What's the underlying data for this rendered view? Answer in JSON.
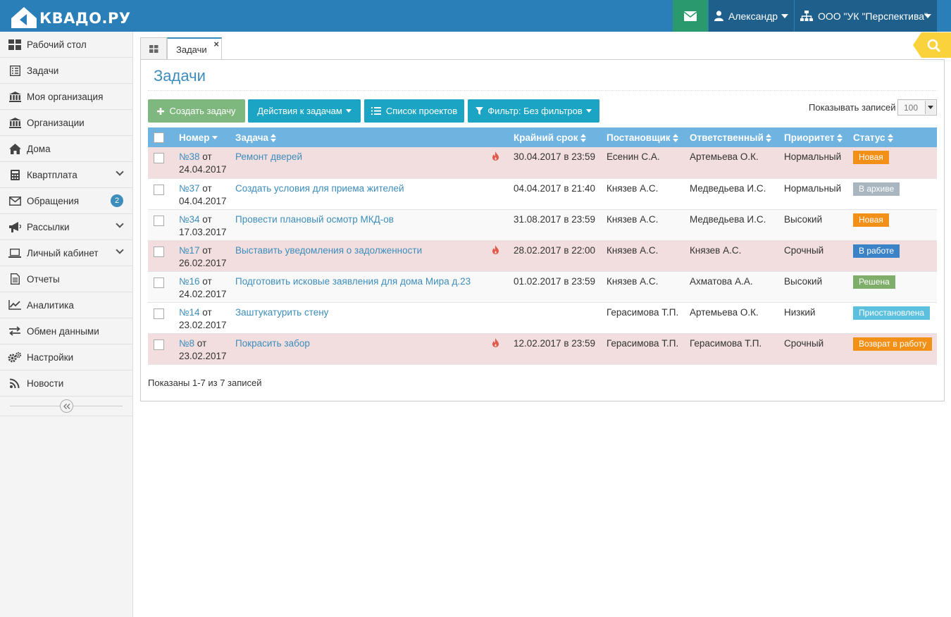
{
  "brand": {
    "logo_text": "КВАДО.РУ"
  },
  "header": {
    "user_name": "Александр",
    "org_name": "ООО \"УК \"Перспектива\""
  },
  "sidebar": {
    "items": [
      {
        "label": "Рабочий стол",
        "icon": "dashboard-icon"
      },
      {
        "label": "Задачи",
        "icon": "tasks-list-icon"
      },
      {
        "label": "Моя организация",
        "icon": "institution-icon"
      },
      {
        "label": "Организации",
        "icon": "institution-icon"
      },
      {
        "label": "Дома",
        "icon": "home-icon"
      },
      {
        "label": "Квартплата",
        "icon": "calculator-icon"
      },
      {
        "label": "Обращения",
        "icon": "envelope-icon",
        "badge": "2"
      },
      {
        "label": "Рассылки",
        "icon": "bullhorn-icon"
      },
      {
        "label": "Личный кабинет",
        "icon": "laptop-icon"
      },
      {
        "label": "Отчеты",
        "icon": "document-icon"
      },
      {
        "label": "Аналитика",
        "icon": "line-chart-icon"
      },
      {
        "label": "Обмен данными",
        "icon": "exchange-icon"
      },
      {
        "label": "Настройки",
        "icon": "gears-icon"
      },
      {
        "label": "Новости",
        "icon": "rss-icon"
      }
    ]
  },
  "tabs": {
    "active_label": "Задачи",
    "close_glyph": "×"
  },
  "page": {
    "title": "Задачи",
    "create_label": "Создать задачу",
    "actions_label": "Действия к задачам",
    "projects_label": "Список проектов",
    "filter_label": "Фильтр: Без фильтров",
    "show_label": "Показывать записей",
    "show_value": "100",
    "footer": "Показаны 1-7 из 7 записей"
  },
  "table": {
    "headers": {
      "number": "Номер",
      "task": "Задача",
      "deadline": "Крайний срок",
      "author": "Постановщик",
      "assignee": "Ответственный",
      "priority": "Приоритет",
      "status": "Статус"
    },
    "rows": [
      {
        "num": "№38",
        "from": "от",
        "date": "24.04.2017",
        "task": "Ремонт дверей",
        "urgent": true,
        "deadline": "30.04.2017 в 23:59",
        "author": "Есенин С.А.",
        "assignee": "Артемьева О.К.",
        "priority": "Нормальный",
        "status": "Новая",
        "status_color": "#f39018"
      },
      {
        "num": "№37",
        "from": "от",
        "date": "04.04.2017",
        "task": "Создать условия для приема жителей",
        "urgent": false,
        "deadline": "04.04.2017 в 21:40",
        "author": "Князев А.С.",
        "assignee": "Медведьева И.С.",
        "priority": "Нормальный",
        "status": "В архиве",
        "status_color": "#a9b6c0"
      },
      {
        "num": "№34",
        "from": "от",
        "date": "17.03.2017",
        "task": "Провести плановый осмотр МКД-ов",
        "urgent": false,
        "deadline": "31.08.2017 в 23:59",
        "author": "Князев А.С.",
        "assignee": "Медведьева И.С.",
        "priority": "Высокий",
        "status": "Новая",
        "status_color": "#f39018"
      },
      {
        "num": "№17",
        "from": "от",
        "date": "26.02.2017",
        "task": "Выставить уведомления о задолженности",
        "urgent": true,
        "deadline": "28.02.2017 в 22:00",
        "author": "Князев А.С.",
        "assignee": "Князев А.С.",
        "priority": "Срочный",
        "status": "В работе",
        "status_color": "#3b82c6"
      },
      {
        "num": "№16",
        "from": "от",
        "date": "24.02.2017",
        "task": "Подготовить исковые заявления для дома Мира д.23",
        "urgent": false,
        "deadline": "01.02.2017 в 23:59",
        "author": "Князев А.С.",
        "assignee": "Ахматова А.А.",
        "priority": "Высокий",
        "status": "Решена",
        "status_color": "#7fae6a"
      },
      {
        "num": "№14",
        "from": "от",
        "date": "23.02.2017",
        "task": "Заштукатурить стену",
        "urgent": false,
        "deadline": "",
        "author": "Герасимова Т.П.",
        "assignee": "Артемьева О.К.",
        "priority": "Низкий",
        "status": "Приостановлена",
        "status_color": "#5bc0de"
      },
      {
        "num": "№8",
        "from": "от",
        "date": "23.02.2017",
        "task": "Покрасить забор",
        "urgent": true,
        "deadline": "12.02.2017 в 23:59",
        "author": "Герасимова Т.П.",
        "assignee": "Герасимова Т.П.",
        "priority": "Срочный",
        "status": "Возврат в работу",
        "status_color": "#f39018"
      }
    ]
  }
}
